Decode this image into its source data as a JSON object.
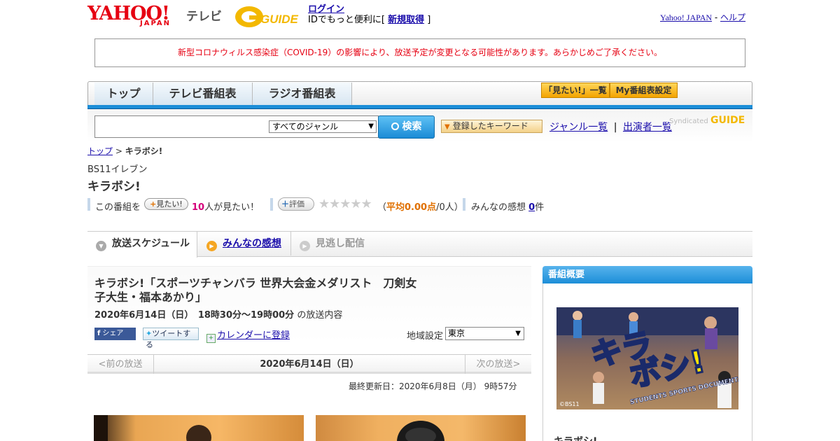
{
  "header": {
    "logo_yahoo": "YAHOO!",
    "logo_japan": "JAPAN",
    "logo_tv": "テレビ",
    "gguide_logo": "G GUIDE",
    "login": "ログイン",
    "id_text_pre": "IDでもっと便利に[",
    "signup": "新規取得",
    "id_text_post": "]",
    "yahoo_japan_link": "Yahoo! JAPAN",
    "sep": " - ",
    "help_link": "ヘルプ"
  },
  "notice": "新型コロナウィルス感染症（COVID-19）の影響により、放送予定が変更となる可能性があります。あらかじめご了承ください。",
  "nav": {
    "tabs": [
      "トップ",
      "テレビ番組表",
      "ラジオ番組表"
    ],
    "mitai_list": "「見たい!」一覧",
    "my_program": "My番組表設定"
  },
  "search": {
    "genre_selected": "すべてのジャンル",
    "button": "検索",
    "keyword_button": "登録したキーワード",
    "genre_list": "ジャンル一覧",
    "sep": "|",
    "performer_list": "出演者一覧",
    "syndicated": "Syndicated",
    "synd_logo": "GUIDE"
  },
  "breadcrumb": {
    "top": "トップ",
    "sep": ">",
    "current": "キラボシ!"
  },
  "program": {
    "station": "BS11イレブン",
    "title": "キラボシ!",
    "mitai_prefix": "この番組を",
    "mitai_button": "見たい!",
    "mitai_count": "10",
    "mitai_suffix": "人が見たい！",
    "hyoka_button": "評価",
    "stars": "★★★★★",
    "avg_open": "（",
    "avg_label": "平均0.00点",
    "avg_rest": "/0人）",
    "kansou_label": "みんなの感想",
    "kansou_count": "0",
    "kansou_unit": "件"
  },
  "tabs": {
    "schedule": "放送スケジュール",
    "reviews": "みんなの感想",
    "replay": "見逃し配信"
  },
  "episode": {
    "title": "キラボシ!「スポーツチャンバラ 世界大会金メダリスト　刀剣女子大生・福本あかり」",
    "date": "2020年6月14日（日）　18時30分～19時00分",
    "date_suffix": "の放送内容",
    "share_fb": "シェア",
    "share_tw": "ツイートする",
    "calendar": "カレンダーに登録",
    "region_label": "地域設定",
    "region_value": "東京"
  },
  "datenav": {
    "prev": "<前の放送",
    "current": "2020年6月14日（日）",
    "next": "次の放送>"
  },
  "updated": "最終更新日：2020年6月8日（月）  9時57分",
  "sidebar": {
    "heading": "番組概要",
    "image_text_1": "キラ",
    "image_text_2": "ボシ!",
    "image_sub": "STUDENTS SPORTS DOCUMENTARY",
    "image_credit": "©BS11",
    "title": "キラボシ!"
  },
  "colors": {
    "accent_blue": "#1c8ed8",
    "notice_red": "#e60012",
    "brand_red": "#e60012",
    "gguide_yellow": "#f3b800"
  }
}
